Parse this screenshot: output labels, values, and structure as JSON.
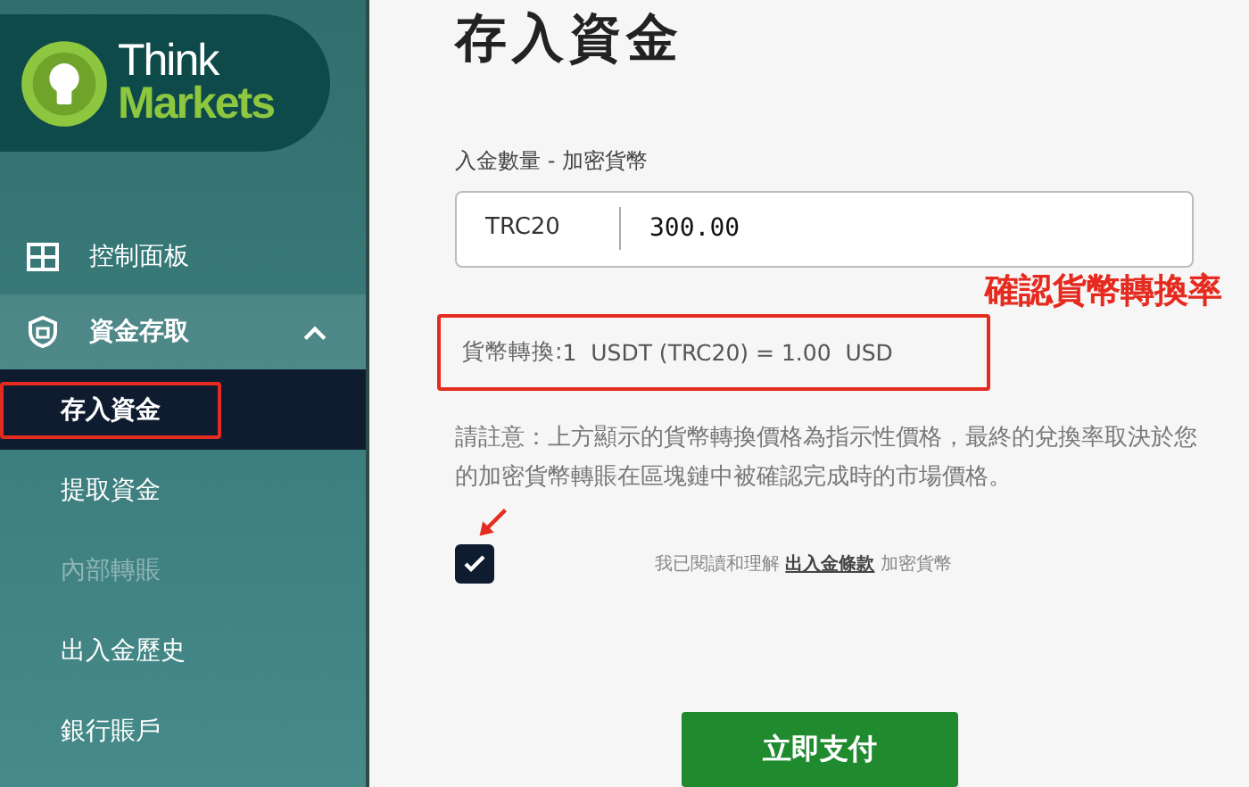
{
  "logo": {
    "line1": "Think",
    "line2": "Markets"
  },
  "sidebar": {
    "items": [
      {
        "kind": "link",
        "label": "控制面板",
        "selected": false
      },
      {
        "kind": "group",
        "label": "資金存取",
        "selected": false,
        "expanded": true,
        "children": [
          {
            "label": "存入資金",
            "selected": true,
            "disabled": false,
            "highlighted": true
          },
          {
            "label": "提取資金",
            "selected": false,
            "disabled": false,
            "highlighted": false
          },
          {
            "label": "內部轉賬",
            "selected": false,
            "disabled": true,
            "highlighted": false
          },
          {
            "label": "出入金歷史",
            "selected": false,
            "disabled": false,
            "highlighted": false
          },
          {
            "label": "銀行賬戶",
            "selected": false,
            "disabled": false,
            "highlighted": false
          }
        ]
      }
    ]
  },
  "page": {
    "title": "存入資金",
    "amount": {
      "label": "入金數量 - 加密貨幣",
      "currency": "TRC20",
      "value": "300.00"
    },
    "annotation": "確認貨幣轉換率",
    "rate": {
      "label": "貨幣轉換:",
      "text": "1  USDT (TRC20) = 1.00  USD",
      "highlighted": true
    },
    "note": "請註意：上方顯示的貨幣轉換價格為指示性價格，最終的兌換率取決於您的加密貨幣轉賬在區塊鏈中被確認完成時的市場價格。",
    "consent": {
      "checked": true,
      "pointed": true,
      "before": "我已閱讀和理解",
      "link": "出入金條款",
      "after": "加密貨幣"
    },
    "submit": "立即支付"
  }
}
